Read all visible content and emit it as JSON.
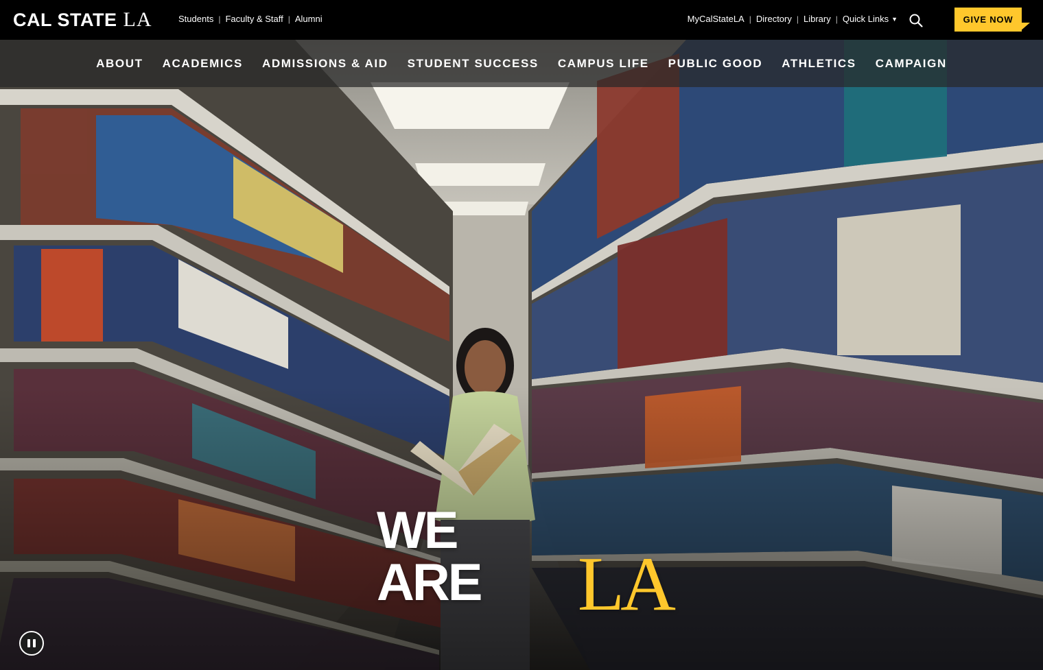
{
  "brand": {
    "logo_part1": "CAL STATE",
    "logo_part2": "LA",
    "accent_color": "#ffc72c",
    "bar_color": "#000000"
  },
  "audience_links": [
    "Students",
    "Faculty & Staff",
    "Alumni"
  ],
  "utility_links": {
    "mycalstatela": "MyCalStateLA",
    "directory": "Directory",
    "library": "Library",
    "quick_links": "Quick Links"
  },
  "search": {
    "icon": "search-icon"
  },
  "give_button": "GIVE NOW",
  "main_nav": [
    "ABOUT",
    "ACADEMICS",
    "ADMISSIONS & AID",
    "STUDENT SUCCESS",
    "CAMPUS LIFE",
    "PUBLIC GOOD",
    "ATHLETICS",
    "CAMPAIGN"
  ],
  "hero": {
    "tagline_part1": "WE ARE",
    "tagline_part2": "LA",
    "video_control_icon": "pause-icon"
  }
}
